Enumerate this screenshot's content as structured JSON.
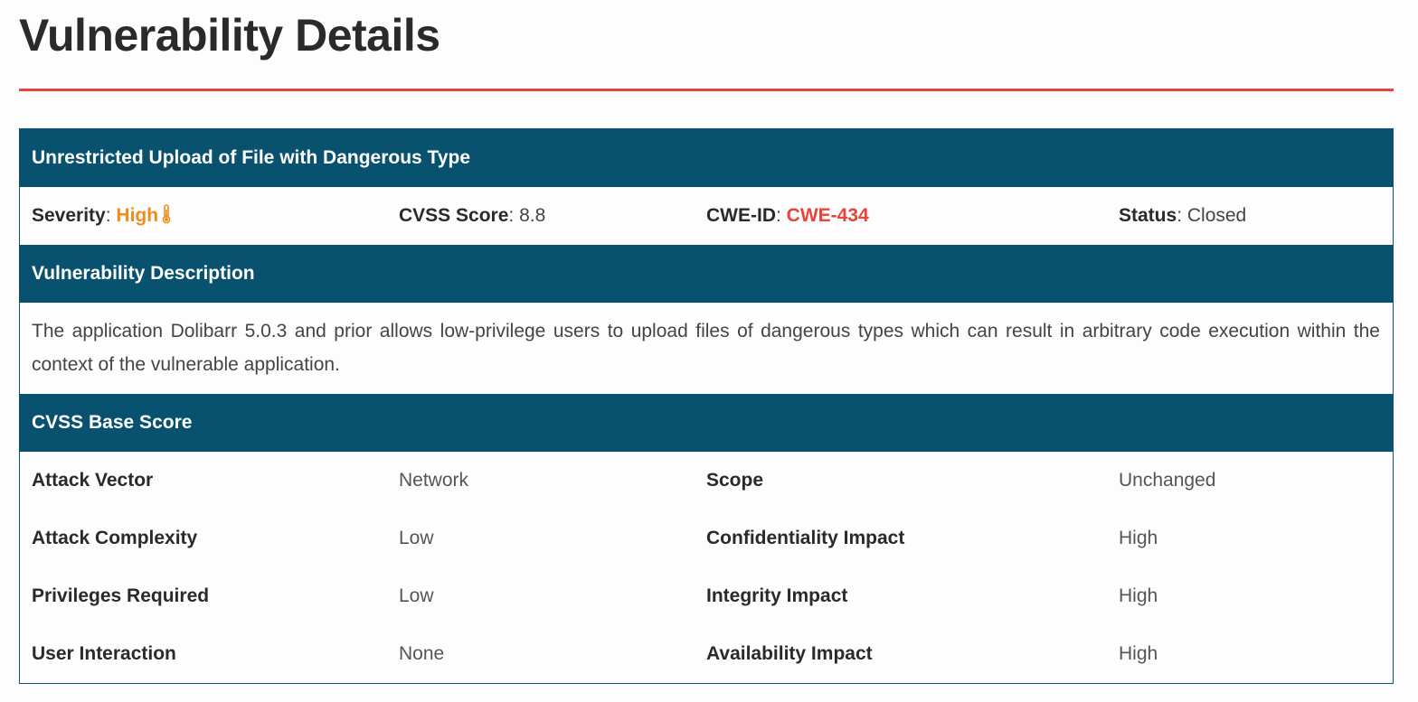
{
  "page": {
    "title": "Vulnerability Details"
  },
  "vulnerability": {
    "name": "Unrestricted Upload of File with Dangerous Type",
    "severity_label": "Severity",
    "severity_value": "High",
    "cvss_label": "CVSS Score",
    "cvss_value": "8.8",
    "cwe_label": "CWE-ID",
    "cwe_value": "CWE-434",
    "status_label": "Status",
    "status_value": "Closed",
    "separator": ": "
  },
  "description": {
    "heading": "Vulnerability Description",
    "text": "The application Dolibarr 5.0.3 and prior allows low-privilege users to upload files of dangerous types which can result in arbitrary code execution within the context of the vulnerable application."
  },
  "cvss_base": {
    "heading": "CVSS Base Score",
    "rows": [
      {
        "left_label": "Attack Vector",
        "left_value": "Network",
        "right_label": "Scope",
        "right_value": "Unchanged"
      },
      {
        "left_label": "Attack Complexity",
        "left_value": "Low",
        "right_label": "Confidentiality Impact",
        "right_value": "High"
      },
      {
        "left_label": "Privileges Required",
        "left_value": "Low",
        "right_label": "Integrity Impact",
        "right_value": "High"
      },
      {
        "left_label": "User Interaction",
        "left_value": "None",
        "right_label": "Availability Impact",
        "right_value": "High"
      }
    ]
  },
  "colors": {
    "accent_rule": "#e8443a",
    "header_band": "#08526f",
    "severity_high": "#f08c1a",
    "cwe_link": "#e8443a"
  },
  "icons": {
    "severity": "thermometer-icon"
  }
}
